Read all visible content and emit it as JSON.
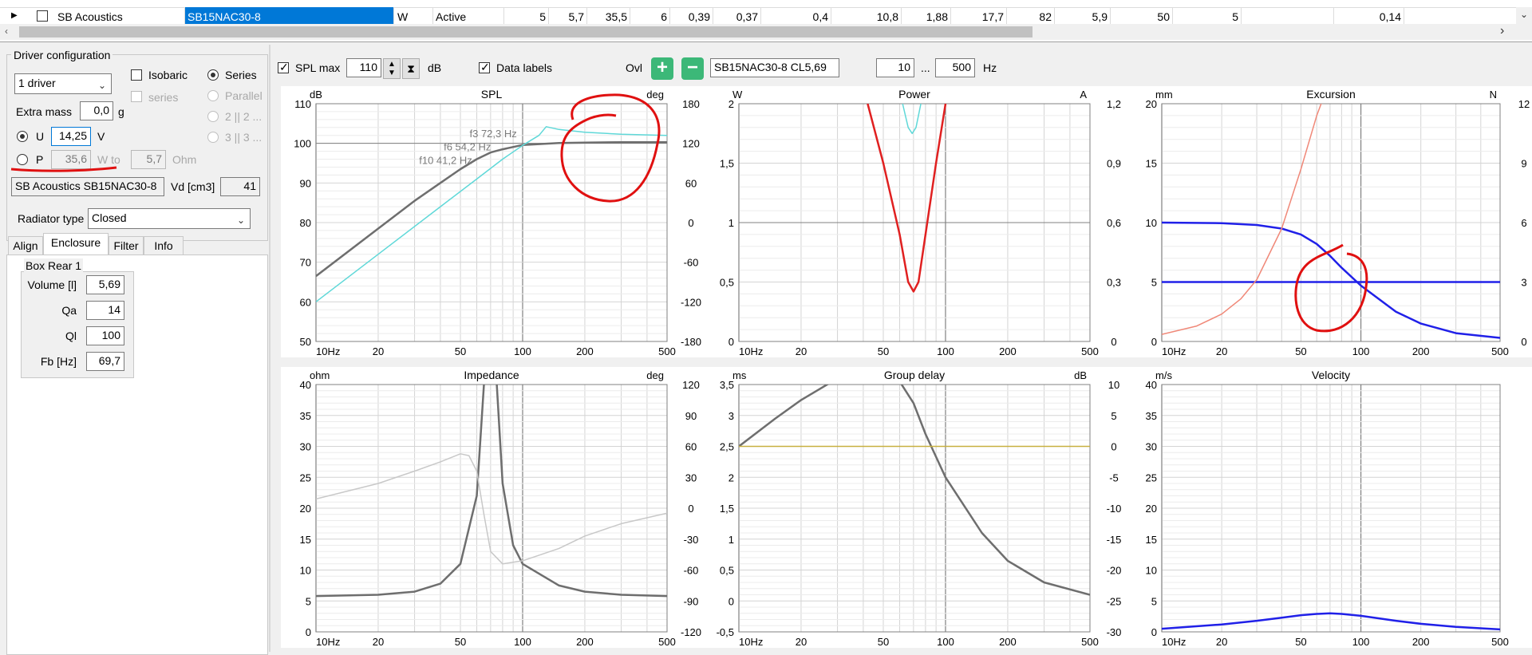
{
  "table": {
    "row": {
      "manufacturer": "SB Acoustics",
      "model": "SB15NAC30-8",
      "type": "W",
      "status": "Active",
      "values": [
        "5",
        "5,7",
        "35,5",
        "6",
        "0,39",
        "0,37",
        "0,4",
        "10,8",
        "1,88",
        "17,7",
        "82",
        "5,9",
        "50",
        "5",
        "",
        "0,14"
      ]
    }
  },
  "left": {
    "group_title": "Driver configuration",
    "driver_count": "1 driver",
    "isobaric_label": "Isobaric",
    "series_sub_label": "series",
    "series_label": "Series",
    "parallel_label": "Parallel",
    "opt2_label": "2 || 2 ...",
    "opt3_label": "3 || 3 ...",
    "extra_mass_label": "Extra mass",
    "extra_mass_value": "0,0",
    "extra_mass_unit": "g",
    "u_label": "U",
    "u_value": "14,25",
    "u_unit": "V",
    "p_label": "P",
    "p_value": "35,6",
    "p_unit": "W to",
    "ohm_value": "5,7",
    "ohm_unit": "Ohm",
    "driver_name": "SB Acoustics SB15NAC30-8",
    "vd_label": "Vd [cm3]",
    "vd_value": "41",
    "radiator_label": "Radiator type",
    "radiator_value": "Closed",
    "tabs": [
      "Align",
      "Enclosure",
      "Filter",
      "Info"
    ],
    "box_title": "Box Rear 1",
    "box_fields": [
      {
        "label": "Volume [l]",
        "value": "5,69"
      },
      {
        "label": "Qa",
        "value": "14"
      },
      {
        "label": "Ql",
        "value": "100"
      },
      {
        "label": "Fb [Hz]",
        "value": "69,7"
      }
    ]
  },
  "toolbar": {
    "spl_max_label": "SPL max",
    "spl_max_value": "110",
    "db_label": "dB",
    "data_labels_label": "Data labels",
    "ovl_label": "Ovl",
    "overlay_name": "SB15NAC30-8 CL5,69",
    "f_min": "10",
    "dots": "...",
    "f_max": "500",
    "hz_label": "Hz"
  },
  "colors": {
    "dark_curve": "#6e6e6e",
    "cyan_curve": "#5fd8d8",
    "red_curve": "#e02020",
    "blue_curve": "#2020e8",
    "salmon_curve": "#f08878",
    "light_gray_curve": "#c8c8c8",
    "gold_line": "#c8b040",
    "annotation": "#e01010",
    "green_button": "#3cb878"
  },
  "icons": {
    "add_overlay": "plus-circle-icon",
    "remove_overlay": "minus-circle-icon",
    "spin": "up-down-arrows-icon",
    "reset": "hourglass-icon"
  },
  "chart_data": [
    {
      "type": "line",
      "title": "SPL",
      "ylabel_left": "dB",
      "ylabel_right": "deg",
      "ylim": [
        50,
        110
      ],
      "ylim_right": [
        -180,
        180
      ],
      "yticks": [
        "110",
        "100",
        "90",
        "80",
        "70",
        "60",
        "50"
      ],
      "yticks_right": [
        "180",
        "120",
        "60",
        "0",
        "-60",
        "-120",
        "-180"
      ],
      "xlim": [
        10,
        500
      ],
      "xscale": "log",
      "xticks": [
        "10Hz",
        "20",
        "50",
        "100",
        "200",
        "500"
      ],
      "grid": true,
      "annotations": [
        "f3 72,3 Hz",
        "f6 54,2 Hz",
        "f10 41,2 Hz"
      ],
      "series": [
        {
          "x": [
            10,
            20,
            30,
            40,
            50,
            60,
            70,
            80,
            100,
            150,
            200,
            300,
            500
          ],
          "y": [
            66.5,
            78.5,
            85.5,
            90,
            93.5,
            96,
            97.7,
            98.5,
            99.6,
            100.1,
            100.2,
            100.3,
            100.3
          ]
        },
        {
          "x": [
            10,
            20,
            40,
            60,
            80,
            100,
            120,
            130,
            150,
            200,
            300,
            500
          ],
          "y": [
            60,
            72,
            84,
            91,
            96,
            99.5,
            102,
            104.2,
            103.5,
            102.8,
            102.3,
            102
          ]
        }
      ]
    },
    {
      "type": "line",
      "title": "Power",
      "ylabel_left": "W",
      "ylabel_right": "A",
      "ylim": [
        0,
        2
      ],
      "ylim_right": [
        0,
        1.2
      ],
      "yticks": [
        "2",
        "1,5",
        "1",
        "0,5",
        "0"
      ],
      "yticks_right": [
        "1,2",
        "0,9",
        "0,6",
        "0,3",
        "0"
      ],
      "xlim": [
        10,
        500
      ],
      "xscale": "log",
      "xticks": [
        "10Hz",
        "20",
        "50",
        "100",
        "200",
        "500"
      ],
      "grid": true,
      "series": [
        {
          "x": [
            42,
            50,
            60,
            66,
            70,
            74,
            80,
            90,
            100
          ],
          "y": [
            2,
            1.5,
            0.9,
            0.5,
            0.42,
            0.5,
            0.9,
            1.5,
            2
          ]
        },
        {
          "x": [
            62,
            66,
            69,
            72,
            76
          ],
          "y": [
            2,
            1.8,
            1.75,
            1.8,
            2
          ]
        }
      ]
    },
    {
      "type": "line",
      "title": "Excursion",
      "ylabel_left": "mm",
      "ylabel_right": "N",
      "ylim": [
        0,
        20
      ],
      "ylim_right": [
        0,
        12
      ],
      "yticks": [
        "20",
        "15",
        "10",
        "5",
        "0"
      ],
      "yticks_right": [
        "12",
        "9",
        "6",
        "3",
        "0"
      ],
      "xlim": [
        10,
        500
      ],
      "xscale": "log",
      "xticks": [
        "10Hz",
        "20",
        "50",
        "100",
        "200",
        "500"
      ],
      "grid": true,
      "series": [
        {
          "x": [
            10,
            20,
            30,
            40,
            50,
            60,
            70,
            80,
            100,
            150,
            200,
            300,
            500
          ],
          "y": [
            10,
            9.95,
            9.8,
            9.5,
            9,
            8.2,
            7.2,
            6.2,
            4.7,
            2.5,
            1.5,
            0.7,
            0.3
          ]
        },
        {
          "x": [
            10,
            20,
            30,
            40,
            500
          ],
          "y": [
            5,
            5,
            5,
            5,
            5
          ]
        },
        {
          "x": [
            10,
            15,
            20,
            25,
            30,
            40,
            50,
            60,
            70
          ],
          "y": [
            0.6,
            1.3,
            2.3,
            3.6,
            5.2,
            9.5,
            14.5,
            19,
            22
          ]
        }
      ]
    },
    {
      "type": "line",
      "title": "Impedance",
      "ylabel_left": "ohm",
      "ylabel_right": "deg",
      "ylim": [
        0,
        40
      ],
      "ylim_right": [
        -120,
        120
      ],
      "yticks": [
        "40",
        "35",
        "30",
        "25",
        "20",
        "15",
        "10",
        "5",
        "0"
      ],
      "yticks_right": [
        "120",
        "90",
        "60",
        "30",
        "0",
        "-30",
        "-60",
        "-90",
        "-120"
      ],
      "xlim": [
        10,
        500
      ],
      "xscale": "log",
      "xticks": [
        "10Hz",
        "20",
        "50",
        "100",
        "200",
        "500"
      ],
      "grid": true,
      "series": [
        {
          "x": [
            10,
            20,
            30,
            40,
            50,
            60,
            65,
            70,
            75,
            80,
            90,
            100,
            150,
            200,
            300,
            500
          ],
          "y": [
            5.8,
            6,
            6.5,
            7.8,
            11,
            22,
            40,
            45,
            40,
            24,
            14,
            11,
            7.5,
            6.5,
            6,
            5.8
          ]
        },
        {
          "x": [
            10,
            20,
            30,
            40,
            50,
            55,
            60,
            65,
            70,
            80,
            100,
            150,
            200,
            300,
            500
          ],
          "y": [
            21.5,
            24,
            26,
            27.5,
            28.8,
            28.5,
            26,
            19,
            13,
            11,
            11.5,
            13.5,
            15.5,
            17.5,
            19.2
          ]
        }
      ]
    },
    {
      "type": "line",
      "title": "Group delay",
      "ylabel_left": "ms",
      "ylabel_right": "dB",
      "ylim": [
        -0.5,
        3.5
      ],
      "ylim_right": [
        -30,
        10
      ],
      "yticks": [
        "3,5",
        "3",
        "2,5",
        "2",
        "1,5",
        "1",
        "0,5",
        "0",
        "-0,5"
      ],
      "yticks_right": [
        "10",
        "5",
        "0",
        "-5",
        "-10",
        "-15",
        "-20",
        "-25",
        "-30"
      ],
      "xlim": [
        10,
        500
      ],
      "xscale": "log",
      "xticks": [
        "10Hz",
        "20",
        "50",
        "100",
        "200",
        "500"
      ],
      "grid": true,
      "series": [
        {
          "x": [
            10,
            15,
            20,
            30,
            40,
            50,
            60,
            70,
            80,
            100,
            150,
            200,
            300,
            500
          ],
          "y": [
            2.5,
            2.95,
            3.25,
            3.6,
            3.8,
            3.7,
            3.55,
            3.2,
            2.7,
            2,
            1.1,
            0.65,
            0.3,
            0.1
          ]
        },
        {
          "x": [
            10,
            500
          ],
          "y": [
            2.5,
            2.5
          ]
        }
      ]
    },
    {
      "type": "line",
      "title": "Velocity",
      "ylabel_left": "m/s",
      "ylim": [
        0,
        40
      ],
      "yticks": [
        "40",
        "35",
        "30",
        "25",
        "20",
        "15",
        "10",
        "5",
        "0"
      ],
      "xlim": [
        10,
        500
      ],
      "xscale": "log",
      "xticks": [
        "10Hz",
        "20",
        "50",
        "100",
        "200",
        "500"
      ],
      "grid": true,
      "series": [
        {
          "x": [
            10,
            20,
            30,
            40,
            50,
            60,
            70,
            80,
            100,
            150,
            200,
            300,
            500
          ],
          "y": [
            0.5,
            1.2,
            1.8,
            2.3,
            2.7,
            2.9,
            3,
            2.9,
            2.6,
            1.8,
            1.3,
            0.8,
            0.4
          ]
        }
      ]
    }
  ]
}
